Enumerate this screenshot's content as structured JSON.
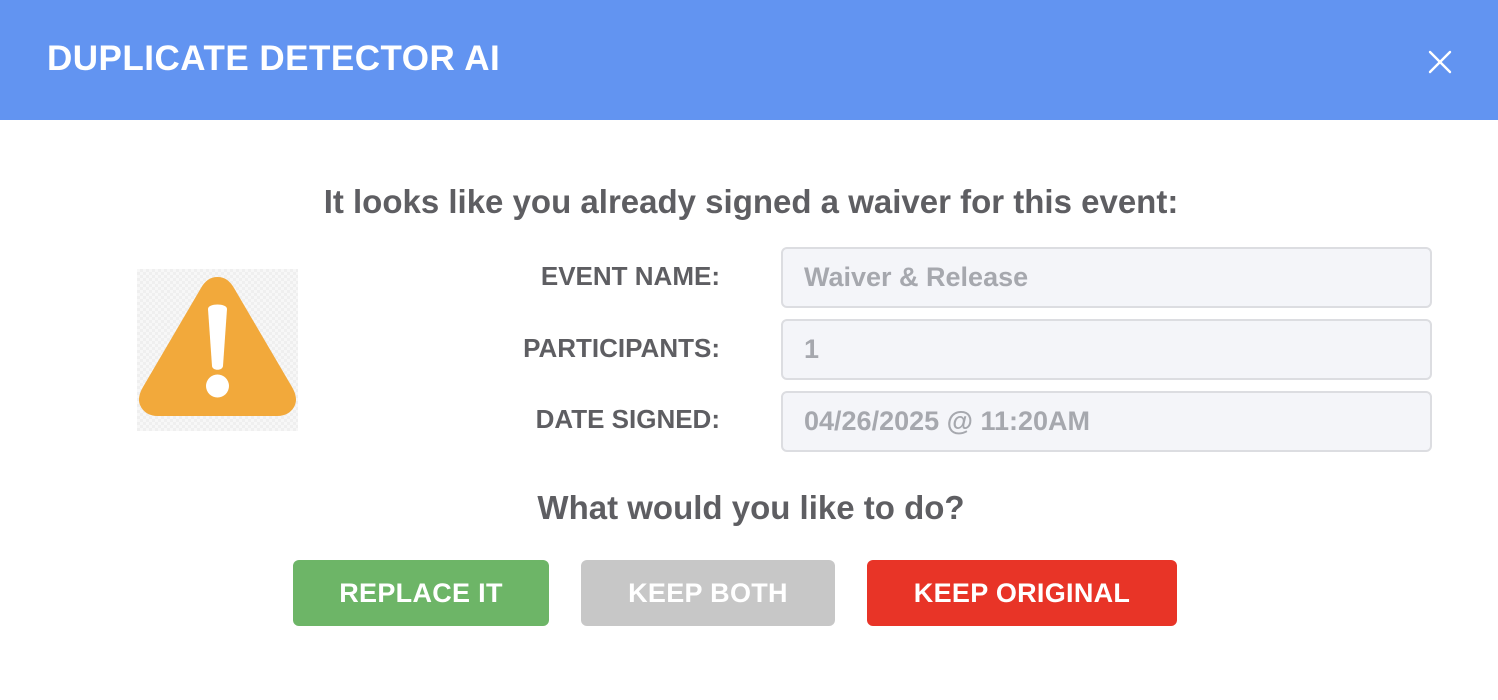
{
  "header": {
    "title": "DUPLICATE DETECTOR AI",
    "close_icon": "close-icon",
    "background_color": "#6294f1"
  },
  "main": {
    "headline": "It looks like you already signed a waiver for this event:",
    "warning_icon": "warning-triangle-icon",
    "warning_color": "#f2a93b",
    "fields": [
      {
        "label": "EVENT NAME:",
        "value": "Waiver & Release"
      },
      {
        "label": "PARTICIPANTS:",
        "value": "1"
      },
      {
        "label": "DATE SIGNED:",
        "value": "04/26/2025 @ 11:20AM"
      }
    ],
    "question": "What would you like to do?"
  },
  "actions": {
    "replace_label": "REPLACE IT",
    "replace_color": "#6db567",
    "keep_both_label": "KEEP BOTH",
    "keep_both_color": "#c7c7c7",
    "keep_original_label": "KEEP ORIGINAL",
    "keep_original_color": "#e83427"
  }
}
